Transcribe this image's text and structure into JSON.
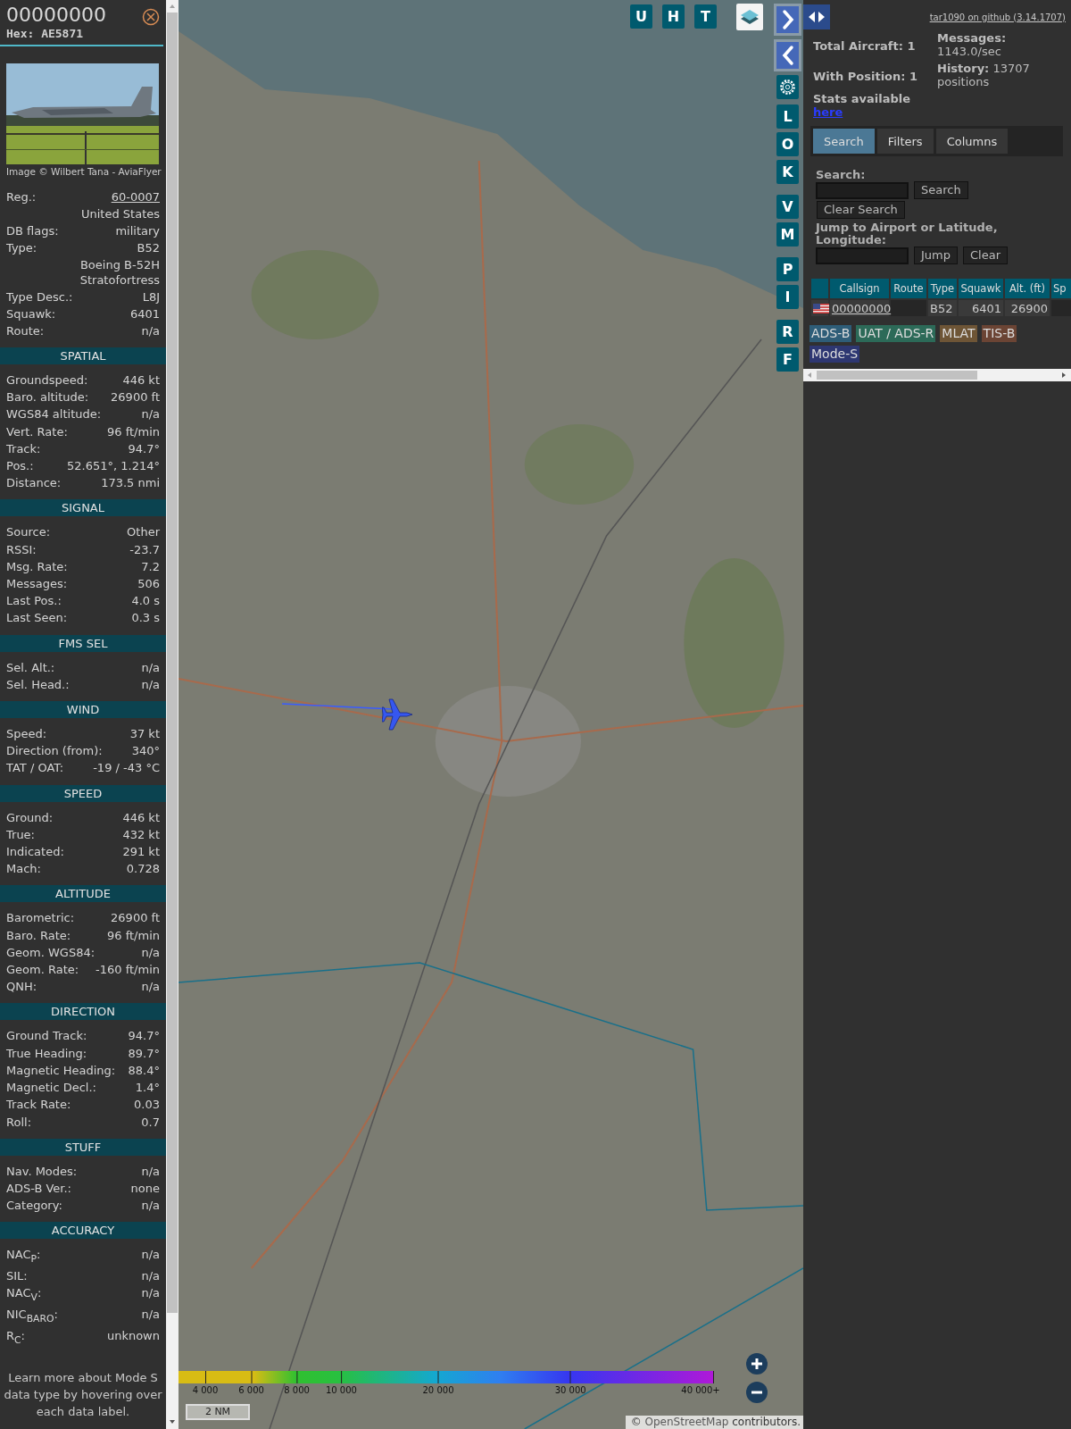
{
  "aircraft_panel": {
    "callsign": "00000000",
    "hex": "Hex: AE5871",
    "photo": {
      "kind": "picture",
      "credit": "Image © Wilbert Tana - AviaFlyer"
    },
    "details": [
      {
        "kind": "link",
        "label": "Reg.:",
        "value": "60-0007"
      },
      {
        "kind": "text",
        "value": "United States"
      },
      {
        "kind": "text",
        "label": "DB flags:",
        "value": "military"
      },
      {
        "kind": "text",
        "label": "Type:",
        "value": "B52"
      },
      {
        "kind": "text",
        "value": "Boeing B-52H Stratofortress"
      },
      {
        "kind": "text",
        "label": "Type Desc.:",
        "value": "L8J"
      },
      {
        "kind": "text",
        "label": "Squawk:",
        "value": "6401"
      },
      {
        "kind": "text",
        "label": "Route:",
        "value": "n/a"
      }
    ],
    "sections": [
      {
        "title": "SPATIAL",
        "rows": [
          {
            "label": "Groundspeed:",
            "value": "446 kt"
          },
          {
            "label": "Baro. altitude:",
            "value": "26900 ft"
          },
          {
            "label": "WGS84 altitude:",
            "value": "n/a"
          },
          {
            "label": "Vert. Rate:",
            "value": "96 ft/min"
          },
          {
            "label": "Track:",
            "value": "94.7°"
          },
          {
            "label": "Pos.:",
            "value": "52.651°, 1.214°"
          },
          {
            "label": "Distance:",
            "value": "173.5 nmi"
          }
        ]
      },
      {
        "title": "SIGNAL",
        "rows": [
          {
            "label": "Source:",
            "value": "Other"
          },
          {
            "label": "RSSI:",
            "value": "-23.7"
          },
          {
            "label": "Msg. Rate:",
            "value": "7.2"
          },
          {
            "label": "Messages:",
            "value": "506"
          },
          {
            "label": "Last Pos.:",
            "value": "4.0 s"
          },
          {
            "label": "Last Seen:",
            "value": "0.3 s"
          }
        ]
      },
      {
        "title": "FMS SEL",
        "rows": [
          {
            "label": "Sel. Alt.:",
            "value": "n/a"
          },
          {
            "label": "Sel. Head.:",
            "value": "n/a"
          }
        ]
      },
      {
        "title": "WIND",
        "rows": [
          {
            "label": "Speed:",
            "value": "37 kt"
          },
          {
            "label": "Direction (from):",
            "value": "340°"
          },
          {
            "label": "TAT / OAT:",
            "value": "-19 / -43 °C"
          }
        ]
      },
      {
        "title": "SPEED",
        "rows": [
          {
            "label": "Ground:",
            "value": "446 kt"
          },
          {
            "label": "True:",
            "value": "432 kt"
          },
          {
            "label": "Indicated:",
            "value": "291 kt"
          },
          {
            "label": "Mach:",
            "value": "0.728"
          }
        ]
      },
      {
        "title": "ALTITUDE",
        "rows": [
          {
            "label": "Barometric:",
            "value": "26900 ft"
          },
          {
            "label": "Baro. Rate:",
            "value": "96 ft/min"
          },
          {
            "label": "Geom. WGS84:",
            "value": "n/a"
          },
          {
            "label": "Geom. Rate:",
            "value": "-160 ft/min"
          },
          {
            "label": "QNH:",
            "value": "n/a"
          }
        ]
      },
      {
        "title": "DIRECTION",
        "rows": [
          {
            "label": "Ground Track:",
            "value": "94.7°"
          },
          {
            "label": "True Heading:",
            "value": "89.7°"
          },
          {
            "label": "Magnetic Heading:",
            "value": "88.4°"
          },
          {
            "label": "Magnetic Decl.:",
            "value": "1.4°"
          },
          {
            "label": "Track Rate:",
            "value": "0.03"
          },
          {
            "label": "Roll:",
            "value": "0.7"
          }
        ]
      },
      {
        "title": "STUFF",
        "rows": [
          {
            "label": "Nav. Modes:",
            "value": "n/a"
          },
          {
            "label": "ADS-B Ver.:",
            "value": "none"
          },
          {
            "label": "Category:",
            "value": "n/a"
          }
        ]
      },
      {
        "title": "ACCURACY",
        "rows": [
          {
            "label": "NAC$_{P}$:",
            "value": "n/a"
          },
          {
            "label": "SIL:",
            "value": "n/a"
          },
          {
            "label": "NAC$_{V}$:",
            "value": "n/a"
          },
          {
            "label": "NIC$_{BARO}$:",
            "value": "n/a"
          },
          {
            "label": "R$_{C}$:",
            "value": "unknown"
          }
        ]
      }
    ],
    "footer": "Learn more about Mode S data type by hovering over each data label."
  },
  "map": {
    "top_buttons": [
      "U",
      "H",
      "T"
    ],
    "side_button_groups": [
      [
        "L",
        "O",
        "K"
      ],
      [
        "V",
        "M"
      ],
      [
        "P",
        "I"
      ],
      [
        "R",
        "F"
      ]
    ],
    "altitude_scale": [
      "4 000",
      "6 000",
      "8 000",
      "10 000",
      "20 000",
      "30 000",
      "40 000+"
    ],
    "scale": "2 NM",
    "attribution": {
      "prefix": "©",
      "link": "OpenStreetMap",
      "suffix": "contributors."
    }
  },
  "right_panel": {
    "version_link": "tar1090 on github (3.14.1707)",
    "stats_left": [
      {
        "label": "Total Aircraft:",
        "value": "1"
      },
      {
        "label": "With Position:",
        "value": "1"
      }
    ],
    "stats_right": [
      {
        "label": "Messages:",
        "value": "1143.0/sec"
      },
      {
        "label": "History:",
        "value": "13707 positions"
      }
    ],
    "stats_link": {
      "text": "Stats available",
      "link": "here"
    },
    "tabs": [
      {
        "label": "Search",
        "selected": true
      },
      {
        "label": "Filters",
        "selected": false
      },
      {
        "label": "Columns",
        "selected": false
      }
    ],
    "search": {
      "label": "Search:",
      "button": "Search",
      "clear_button": "Clear Search"
    },
    "jump": {
      "label": "Jump to Airport or Latitude, Longitude:",
      "button": "Jump",
      "clear_button": "Clear"
    },
    "table": {
      "columns": [
        "Callsign",
        "Route",
        "Type",
        "Squawk",
        "Alt. (ft)",
        "Sp"
      ],
      "rows": [
        {
          "callsign": "00000000",
          "type": "B52",
          "squawk": "6401",
          "altitude": "26900"
        }
      ]
    },
    "legend": [
      {
        "label": "ADS-B",
        "color": "#2e5d78"
      },
      {
        "label": "UAT / ADS-R",
        "color": "#2c6a58"
      },
      {
        "label": "MLAT",
        "color": "#6e5536"
      },
      {
        "label": "TIS-B",
        "color": "#6b4434"
      },
      {
        "label": "Mode-S",
        "color": "#2e3772"
      }
    ]
  }
}
